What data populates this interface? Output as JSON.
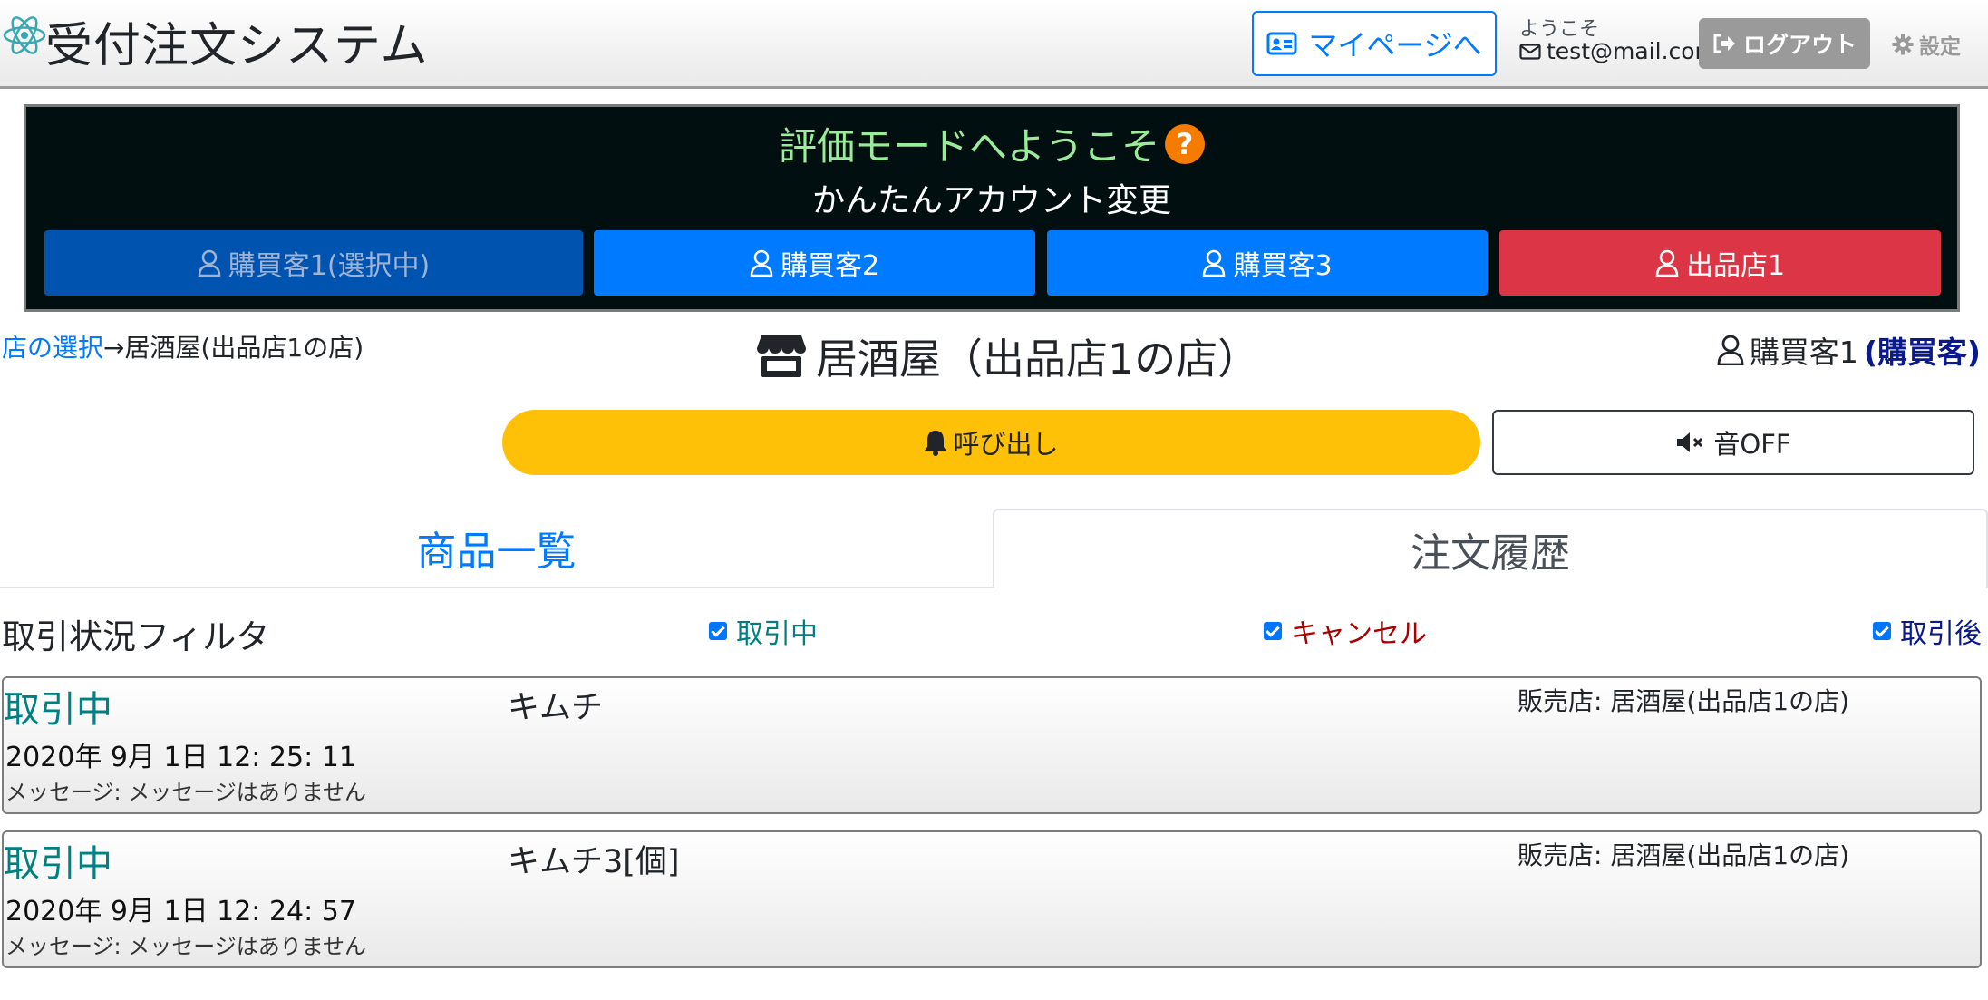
{
  "header": {
    "app_title": "受付注文システム",
    "mypage_label": "マイページへ",
    "welcome_label": "ようこそ",
    "user_email": "test@mail.com",
    "logout_label": "ログアウト",
    "settings_label": "設定"
  },
  "eval_panel": {
    "title": "評価モードへようこそ",
    "subtitle": "かんたんアカウント変更",
    "accounts": [
      {
        "label": "購買客1(選択中)",
        "color": "#0053ae",
        "selected": true
      },
      {
        "label": "購買客2",
        "color": "#007bff",
        "selected": false
      },
      {
        "label": "購買客3",
        "color": "#007bff",
        "selected": false
      },
      {
        "label": "出品店1",
        "color": "#dc3545",
        "selected": false
      }
    ]
  },
  "breadcrumb": {
    "link": "店の選択",
    "separator": "→",
    "current": "居酒屋(出品店1の店)"
  },
  "shop_title": "居酒屋（出品店1の店）",
  "current_user": {
    "name": "購買客1",
    "role": "(購買客)"
  },
  "actions": {
    "call_label": "呼び出し",
    "sound_label": "音OFF"
  },
  "tabs": [
    {
      "label": "商品一覧",
      "active": false
    },
    {
      "label": "注文履歴",
      "active": true
    }
  ],
  "filter": {
    "title": "取引状況フィルタ",
    "options": [
      {
        "label": "取引中",
        "checked": true,
        "color": "#008080"
      },
      {
        "label": "キャンセル",
        "checked": true,
        "color": "#a80000"
      },
      {
        "label": "取引後",
        "checked": true,
        "color": "#0a1a8c"
      }
    ]
  },
  "orders": [
    {
      "status": "取引中",
      "item": "キムチ",
      "shop": "販売店: 居酒屋(出品店1の店)",
      "date": "2020年 9月 1日 12: 25: 11",
      "message": "メッセージ: メッセージはありません"
    },
    {
      "status": "取引中",
      "item": "キムチ3[個]",
      "shop": "販売店: 居酒屋(出品店1の店)",
      "date": "2020年 9月 1日 12: 24: 57",
      "message": "メッセージ: メッセージはありません"
    }
  ],
  "colors": {
    "primary": "#007bff",
    "warning": "#ffc107",
    "danger": "#dc3545",
    "status_active": "#008080",
    "eval_panel_bg": "#020f10"
  }
}
